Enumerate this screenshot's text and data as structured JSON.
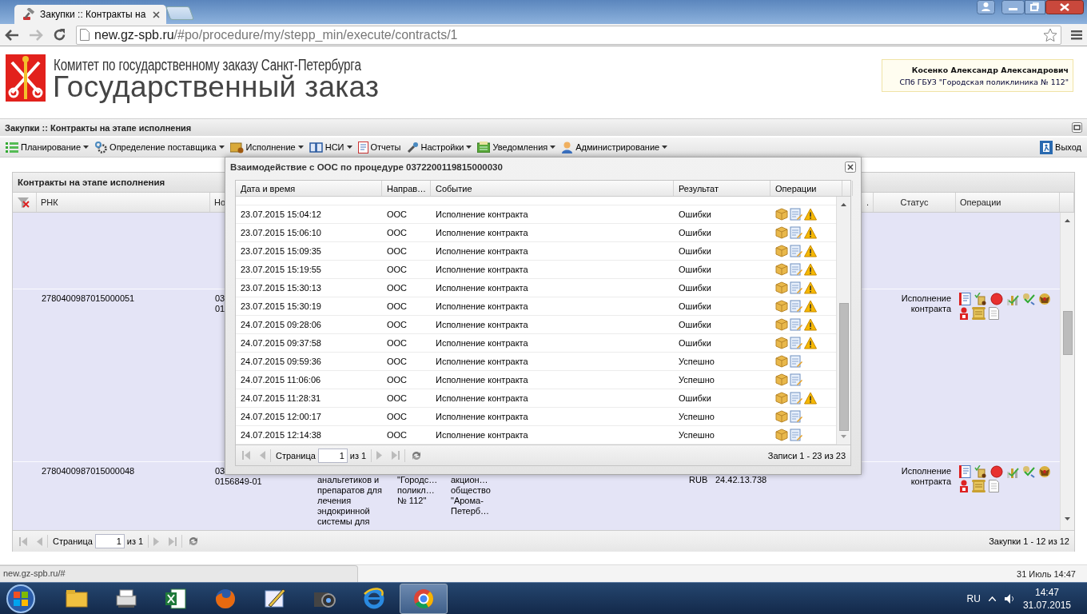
{
  "browser": {
    "tab_title": "Закупки :: Контракты на",
    "url_host": "new.gz-spb.ru",
    "url_path": "/#po/procedure/my/stepp_min/execute/contracts/1"
  },
  "header": {
    "org": "Комитет по государственному заказу Санкт-Петербурга",
    "title": "Государственный заказ",
    "user_name": "Косенко Александр Александрович",
    "user_org": "СПб ГБУЗ \"Городская поликлиника № 112\""
  },
  "panel_title": "Закупки :: Контракты на этапе исполнения",
  "menu": [
    {
      "kind": "planning",
      "label": "Планирование",
      "dropdown": true
    },
    {
      "kind": "gears",
      "label": "Определение поставщика",
      "dropdown": true
    },
    {
      "kind": "execution",
      "label": "Исполнение",
      "dropdown": true
    },
    {
      "kind": "book",
      "label": "НСИ",
      "dropdown": true
    },
    {
      "kind": "report",
      "label": "Отчеты",
      "dropdown": false
    },
    {
      "kind": "wrench",
      "label": "Настройки",
      "dropdown": true
    },
    {
      "kind": "notice",
      "label": "Уведомления",
      "dropdown": true
    },
    {
      "kind": "user",
      "label": "Администрирование",
      "dropdown": true
    }
  ],
  "logout": "Выход",
  "grid": {
    "title": "Контракты на этапе исполнения",
    "columns": [
      {
        "label": "РНК"
      },
      {
        "label": "Но"
      },
      {
        "label": "."
      },
      {
        "label": "Статус"
      },
      {
        "label": "Операции"
      }
    ],
    "rows": [
      {
        "rnk": "2780400987015000051",
        "number": "03\n01",
        "status": "Исполнение контракта"
      },
      {
        "rnk": "2780400987015000048",
        "number": "03\n0156849-01",
        "description": "анальгетиков и\nпрепаратов для\nлечения\nэндокринной\nсистемы для",
        "customer": "\"Городс…\nполикл…\n№ 112\"",
        "supplier": "акцион…\nобщество\n\"Арома-\nПетерб…",
        "currency": "RUB",
        "price": "24.42.13.738",
        "status": "Исполнение контракта"
      }
    ],
    "paging": {
      "page_label": "Страница",
      "page": "1",
      "of": "из 1",
      "summary": "Закупки 1 - 12 из 12"
    }
  },
  "dialog": {
    "title": "Взаимодействие с ООС по процедуре 0372200119815000030",
    "columns": [
      "Дата и время",
      "Направ…",
      "Событие",
      "Результат",
      "Операции"
    ],
    "rows": [
      {
        "datetime": "23.07.2015 15:04:12",
        "direction": "ООС",
        "event": "Исполнение контракта",
        "result": "Ошибки",
        "warning": true
      },
      {
        "datetime": "23.07.2015 15:06:10",
        "direction": "ООС",
        "event": "Исполнение контракта",
        "result": "Ошибки",
        "warning": true
      },
      {
        "datetime": "23.07.2015 15:09:35",
        "direction": "ООС",
        "event": "Исполнение контракта",
        "result": "Ошибки",
        "warning": true
      },
      {
        "datetime": "23.07.2015 15:19:55",
        "direction": "ООС",
        "event": "Исполнение контракта",
        "result": "Ошибки",
        "warning": true
      },
      {
        "datetime": "23.07.2015 15:30:13",
        "direction": "ООС",
        "event": "Исполнение контракта",
        "result": "Ошибки",
        "warning": true
      },
      {
        "datetime": "23.07.2015 15:30:19",
        "direction": "ООС",
        "event": "Исполнение контракта",
        "result": "Ошибки",
        "warning": true
      },
      {
        "datetime": "24.07.2015 09:28:06",
        "direction": "ООС",
        "event": "Исполнение контракта",
        "result": "Ошибки",
        "warning": true
      },
      {
        "datetime": "24.07.2015 09:37:58",
        "direction": "ООС",
        "event": "Исполнение контракта",
        "result": "Ошибки",
        "warning": true
      },
      {
        "datetime": "24.07.2015 09:59:36",
        "direction": "ООС",
        "event": "Исполнение контракта",
        "result": "Успешно",
        "warning": false
      },
      {
        "datetime": "24.07.2015 11:06:06",
        "direction": "ООС",
        "event": "Исполнение контракта",
        "result": "Успешно",
        "warning": false
      },
      {
        "datetime": "24.07.2015 11:28:31",
        "direction": "ООС",
        "event": "Исполнение контракта",
        "result": "Ошибки",
        "warning": true
      },
      {
        "datetime": "24.07.2015 12:00:17",
        "direction": "ООС",
        "event": "Исполнение контракта",
        "result": "Успешно",
        "warning": false
      },
      {
        "datetime": "24.07.2015 12:14:38",
        "direction": "ООС",
        "event": "Исполнение контракта",
        "result": "Успешно",
        "warning": false
      }
    ],
    "paging": {
      "page_label": "Страница",
      "page": "1",
      "of": "из 1",
      "summary": "Записи 1 - 23 из 23"
    }
  },
  "status_url": "new.gz-spb.ru/#",
  "page_clock": "31 Июль 14:47",
  "taskbar": {
    "language": "RU",
    "time": "14:47",
    "date": "31.07.2015"
  }
}
